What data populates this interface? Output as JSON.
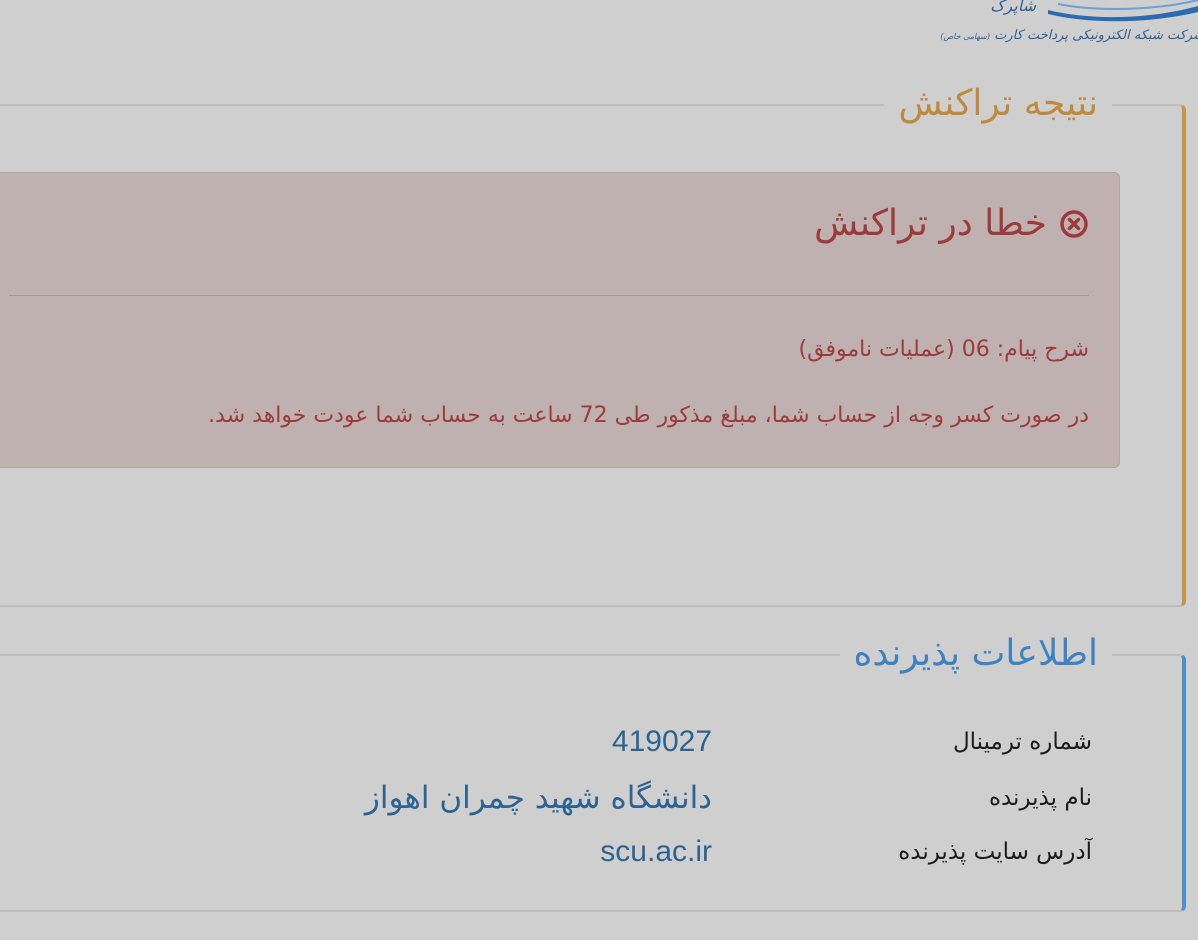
{
  "logo": {
    "name": "شاپرک",
    "tagline": "شرکت شبکه الکترونیکی پرداخت کارت",
    "tagline_suffix": "(سهامی خاص)"
  },
  "result": {
    "title": "نتیجه تراکنش",
    "alert": {
      "heading": "خطا در تراکنش",
      "icon": "times-circle-icon",
      "message_label": "شرح پیام:",
      "message_code": "06",
      "message_text": "(عملیات ناموفق)",
      "refund_note": "در صورت کسر وجه از حساب شما، مبلغ مذکور طی 72 ساعت به حساب شما عودت خواهد شد."
    }
  },
  "merchant": {
    "title": "اطلاعات پذیرنده",
    "rows": [
      {
        "label": "شماره ترمینال",
        "value": "419027"
      },
      {
        "label": "نام پذیرنده",
        "value": "دانشگاه شهید چمران اهواز"
      },
      {
        "label": "آدرس سایت پذیرنده",
        "value": "scu.ac.ir"
      }
    ]
  },
  "colors": {
    "background": "#cfcfcf",
    "result_accent": "#c08a3e",
    "merchant_accent": "#3f82c2",
    "alert_bg": "#c0b1b1",
    "alert_text": "#9b3b3b",
    "value_text": "#2c6391"
  }
}
